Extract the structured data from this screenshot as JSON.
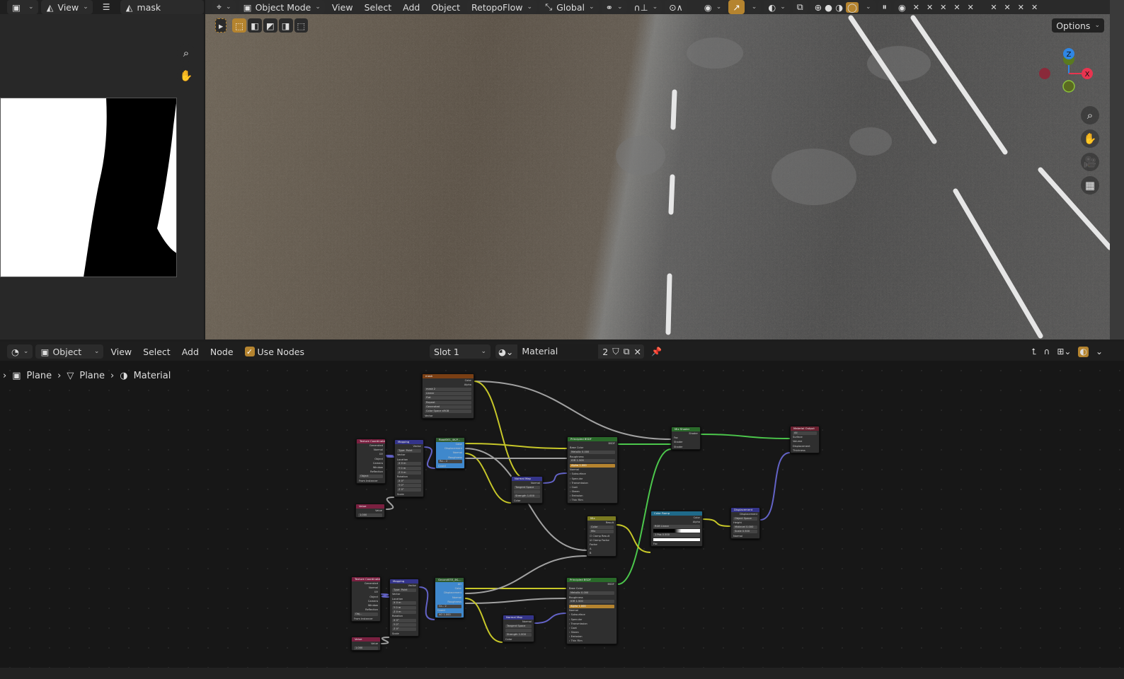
{
  "image_editor": {
    "view_menu": "View",
    "image_name": "mask",
    "icons": [
      "image-editor-icon",
      "image-icon",
      "hamburger-icon",
      "zoom-icon",
      "hand-pan-icon"
    ]
  },
  "viewport_header": {
    "mode": "Object Mode",
    "menus": [
      "View",
      "Select",
      "Add",
      "Object"
    ],
    "addon": "RetopoFlow",
    "orientation": "Global",
    "options": "Options"
  },
  "viewport_gizmo": {
    "axes": [
      "Z",
      "X"
    ],
    "colors": {
      "x": "#e8344f",
      "y": "#8bc23a",
      "z": "#2f86e4"
    }
  },
  "node_header": {
    "editor": "Object",
    "menus": [
      "View",
      "Select",
      "Add",
      "Node"
    ],
    "use_nodes_label": "Use Nodes",
    "use_nodes_checked": true,
    "slot": "Slot 1",
    "material": "Material",
    "users": "2"
  },
  "breadcrumb": [
    "Plane",
    "Plane",
    "Material"
  ],
  "accent": "#b5842f",
  "nodes": [
    {
      "id": "mask",
      "title": "mask",
      "color": "#7a3f14",
      "rows": [
        [
          "r",
          "Color"
        ],
        [
          "r",
          "Alpha"
        ],
        [
          "f",
          "mask   2"
        ],
        [
          "f",
          "Linear"
        ],
        [
          "f",
          "Flat"
        ],
        [
          "f",
          "Repeat"
        ],
        [
          "f",
          "Generated"
        ],
        [
          "f",
          "Color Space   sRGB"
        ],
        [
          "l",
          "Vector"
        ]
      ]
    },
    {
      "id": "tc1",
      "title": "Texture Coordinate",
      "color": "#7a2040",
      "rows": [
        [
          "r",
          "Generated"
        ],
        [
          "r",
          "Normal"
        ],
        [
          "r",
          "UV"
        ],
        [
          "r",
          "Object"
        ],
        [
          "r",
          "Camera"
        ],
        [
          "r",
          "Window"
        ],
        [
          "r",
          "Reflection"
        ],
        [
          "f",
          "Object"
        ],
        [
          "l",
          "From Instancer"
        ]
      ]
    },
    {
      "id": "map1",
      "title": "Mapping",
      "color": "#34348a",
      "rows": [
        [
          "r",
          "Vector"
        ],
        [
          "f",
          "Type: Point"
        ],
        [
          "l",
          "Vector"
        ],
        [
          "l",
          "Location"
        ],
        [
          "f",
          "X   0 m"
        ],
        [
          "f",
          "Y   0 m"
        ],
        [
          "f",
          "Z   0 m"
        ],
        [
          "l",
          "Rotation"
        ],
        [
          "f",
          "X   0°"
        ],
        [
          "f",
          "Y   0°"
        ],
        [
          "f",
          "Z   0°"
        ],
        [
          "l",
          "Scale"
        ]
      ]
    },
    {
      "id": "val1",
      "title": "Value",
      "color": "#7a2040",
      "rows": [
        [
          "r",
          "Value"
        ],
        [
          "f",
          "1.000"
        ]
      ]
    },
    {
      "id": "tex1",
      "title": "Road001_4K-P...",
      "color": "#2f5a2f",
      "body": "#3f88cc",
      "rows": [
        [
          "r",
          "Color"
        ],
        [
          "r",
          "Displacement"
        ],
        [
          "r",
          "Normal"
        ],
        [
          "r",
          "Roughness"
        ],
        [
          "f",
          "Ro...   2"
        ],
        [
          "l",
          "Coord"
        ]
      ]
    },
    {
      "id": "nm1",
      "title": "Normal Map",
      "color": "#34348a",
      "rows": [
        [
          "r",
          "Normal"
        ],
        [
          "f",
          "Tangent Space"
        ],
        [
          "f",
          ""
        ],
        [
          "f",
          "Strength   1.000"
        ],
        [
          "l",
          "Color"
        ]
      ]
    },
    {
      "id": "bsdf1",
      "title": "Principled BSDF",
      "color": "#2a6a2a",
      "rows": [
        [
          "r",
          "BSDF"
        ],
        [
          "l",
          "Base Color"
        ],
        [
          "f",
          "Metallic   0.000"
        ],
        [
          "l",
          "Roughness"
        ],
        [
          "f",
          "IOR   1.500"
        ],
        [
          "h",
          "Alpha   1.000"
        ],
        [
          "l",
          "Normal"
        ],
        [
          "l",
          "› Subsurface"
        ],
        [
          "l",
          "› Specular"
        ],
        [
          "l",
          "› Transmission"
        ],
        [
          "l",
          "› Coat"
        ],
        [
          "l",
          "› Sheen"
        ],
        [
          "l",
          "› Emission"
        ],
        [
          "l",
          "› Thin Film"
        ]
      ]
    },
    {
      "id": "mixs",
      "title": "Mix Shader",
      "color": "#2a6a2a",
      "rows": [
        [
          "r",
          "Shader"
        ],
        [
          "l",
          "Fac"
        ],
        [
          "l",
          "Shader"
        ],
        [
          "l",
          "Shader"
        ]
      ]
    },
    {
      "id": "out",
      "title": "Material Output",
      "color": "#6a2030",
      "rows": [
        [
          "f",
          "All"
        ],
        [
          "l",
          "Surface"
        ],
        [
          "l",
          "Volume"
        ],
        [
          "l",
          "Displacement"
        ],
        [
          "l",
          "Thickness"
        ]
      ]
    },
    {
      "id": "mix",
      "title": "Mix",
      "color": "#7a7a20",
      "rows": [
        [
          "r",
          "Result"
        ],
        [
          "f",
          "Color"
        ],
        [
          "f",
          "Mix"
        ],
        [
          "l",
          "☐ Clamp Result"
        ],
        [
          "l",
          "☑ Clamp Factor"
        ],
        [
          "l",
          "Factor"
        ],
        [
          "l",
          "A"
        ],
        [
          "l",
          "B"
        ]
      ]
    },
    {
      "id": "ramp",
      "title": "Color Ramp",
      "color": "#1f6a8a",
      "rows": [
        [
          "r",
          "Color"
        ],
        [
          "r",
          "Alpha"
        ],
        [
          "f",
          "RGB   Linear"
        ],
        [
          "g",
          ""
        ],
        [
          "f",
          "1   Pos   0.500"
        ],
        [
          "w",
          ""
        ],
        [
          "l",
          "Fac"
        ]
      ]
    },
    {
      "id": "disp",
      "title": "Displacement",
      "color": "#34348a",
      "rows": [
        [
          "r",
          "Displacement"
        ],
        [
          "f",
          "Object Space"
        ],
        [
          "l",
          "Height"
        ],
        [
          "f",
          "Midlevel   0.000"
        ],
        [
          "f",
          "Scale   0.500"
        ],
        [
          "l",
          "Normal"
        ]
      ]
    },
    {
      "id": "tc2",
      "title": "Texture Coordinate",
      "color": "#7a2040",
      "rows": [
        [
          "r",
          "Generated"
        ],
        [
          "r",
          "Normal"
        ],
        [
          "r",
          "UV"
        ],
        [
          "r",
          "Object"
        ],
        [
          "r",
          "Camera"
        ],
        [
          "r",
          "Window"
        ],
        [
          "r",
          "Reflection"
        ],
        [
          "f",
          "Obj..."
        ],
        [
          "l",
          "From Instancer"
        ]
      ]
    },
    {
      "id": "map2",
      "title": "Mapping",
      "color": "#34348a",
      "rows": [
        [
          "r",
          "Vector"
        ],
        [
          "f",
          "Type: Point"
        ],
        [
          "l",
          "Vector"
        ],
        [
          "l",
          "Location"
        ],
        [
          "f",
          "X   0 m"
        ],
        [
          "f",
          "Y   0 m"
        ],
        [
          "f",
          "Z   0 m"
        ],
        [
          "l",
          "Rotation"
        ],
        [
          "f",
          "X   0°"
        ],
        [
          "f",
          "Y   0°"
        ],
        [
          "f",
          "Z   0°"
        ],
        [
          "l",
          "Scale"
        ]
      ]
    },
    {
      "id": "val2",
      "title": "Value",
      "color": "#7a2040",
      "rows": [
        [
          "r",
          "Value"
        ],
        [
          "f",
          "1.000"
        ]
      ]
    },
    {
      "id": "tex2",
      "title": "Ground033_4K-...",
      "color": "#2f5a2f",
      "body": "#3f88cc",
      "rows": [
        [
          "r",
          "AO"
        ],
        [
          "r",
          "Color"
        ],
        [
          "r",
          "Displacement"
        ],
        [
          "r",
          "Normal"
        ],
        [
          "r",
          "Roughness"
        ],
        [
          "f",
          "Gr...   2"
        ],
        [
          "l",
          "Coord"
        ],
        [
          "f",
          "AO   1.000"
        ]
      ]
    },
    {
      "id": "nm2",
      "title": "Normal Map",
      "color": "#34348a",
      "rows": [
        [
          "r",
          "Normal"
        ],
        [
          "f",
          "Tangent Space"
        ],
        [
          "f",
          ""
        ],
        [
          "f",
          "Strength   1.000"
        ],
        [
          "l",
          "Color"
        ]
      ]
    },
    {
      "id": "bsdf2",
      "title": "Principled BSDF",
      "color": "#2a6a2a",
      "rows": [
        [
          "r",
          "BSDF"
        ],
        [
          "l",
          "Base Color"
        ],
        [
          "f",
          "Metallic   0.000"
        ],
        [
          "l",
          "Roughness"
        ],
        [
          "f",
          "IOR   1.500"
        ],
        [
          "h",
          "Alpha   1.000"
        ],
        [
          "l",
          "Normal"
        ],
        [
          "l",
          "› Subsurface"
        ],
        [
          "l",
          "› Specular"
        ],
        [
          "l",
          "› Transmission"
        ],
        [
          "l",
          "› Coat"
        ],
        [
          "l",
          "› Sheen"
        ],
        [
          "l",
          "› Emission"
        ],
        [
          "l",
          "› Thin Film"
        ]
      ]
    }
  ],
  "link_colors": {
    "color": "#c7c729",
    "float": "#a1a1a1",
    "vector": "#6363c7",
    "shader": "#4cc74c"
  }
}
